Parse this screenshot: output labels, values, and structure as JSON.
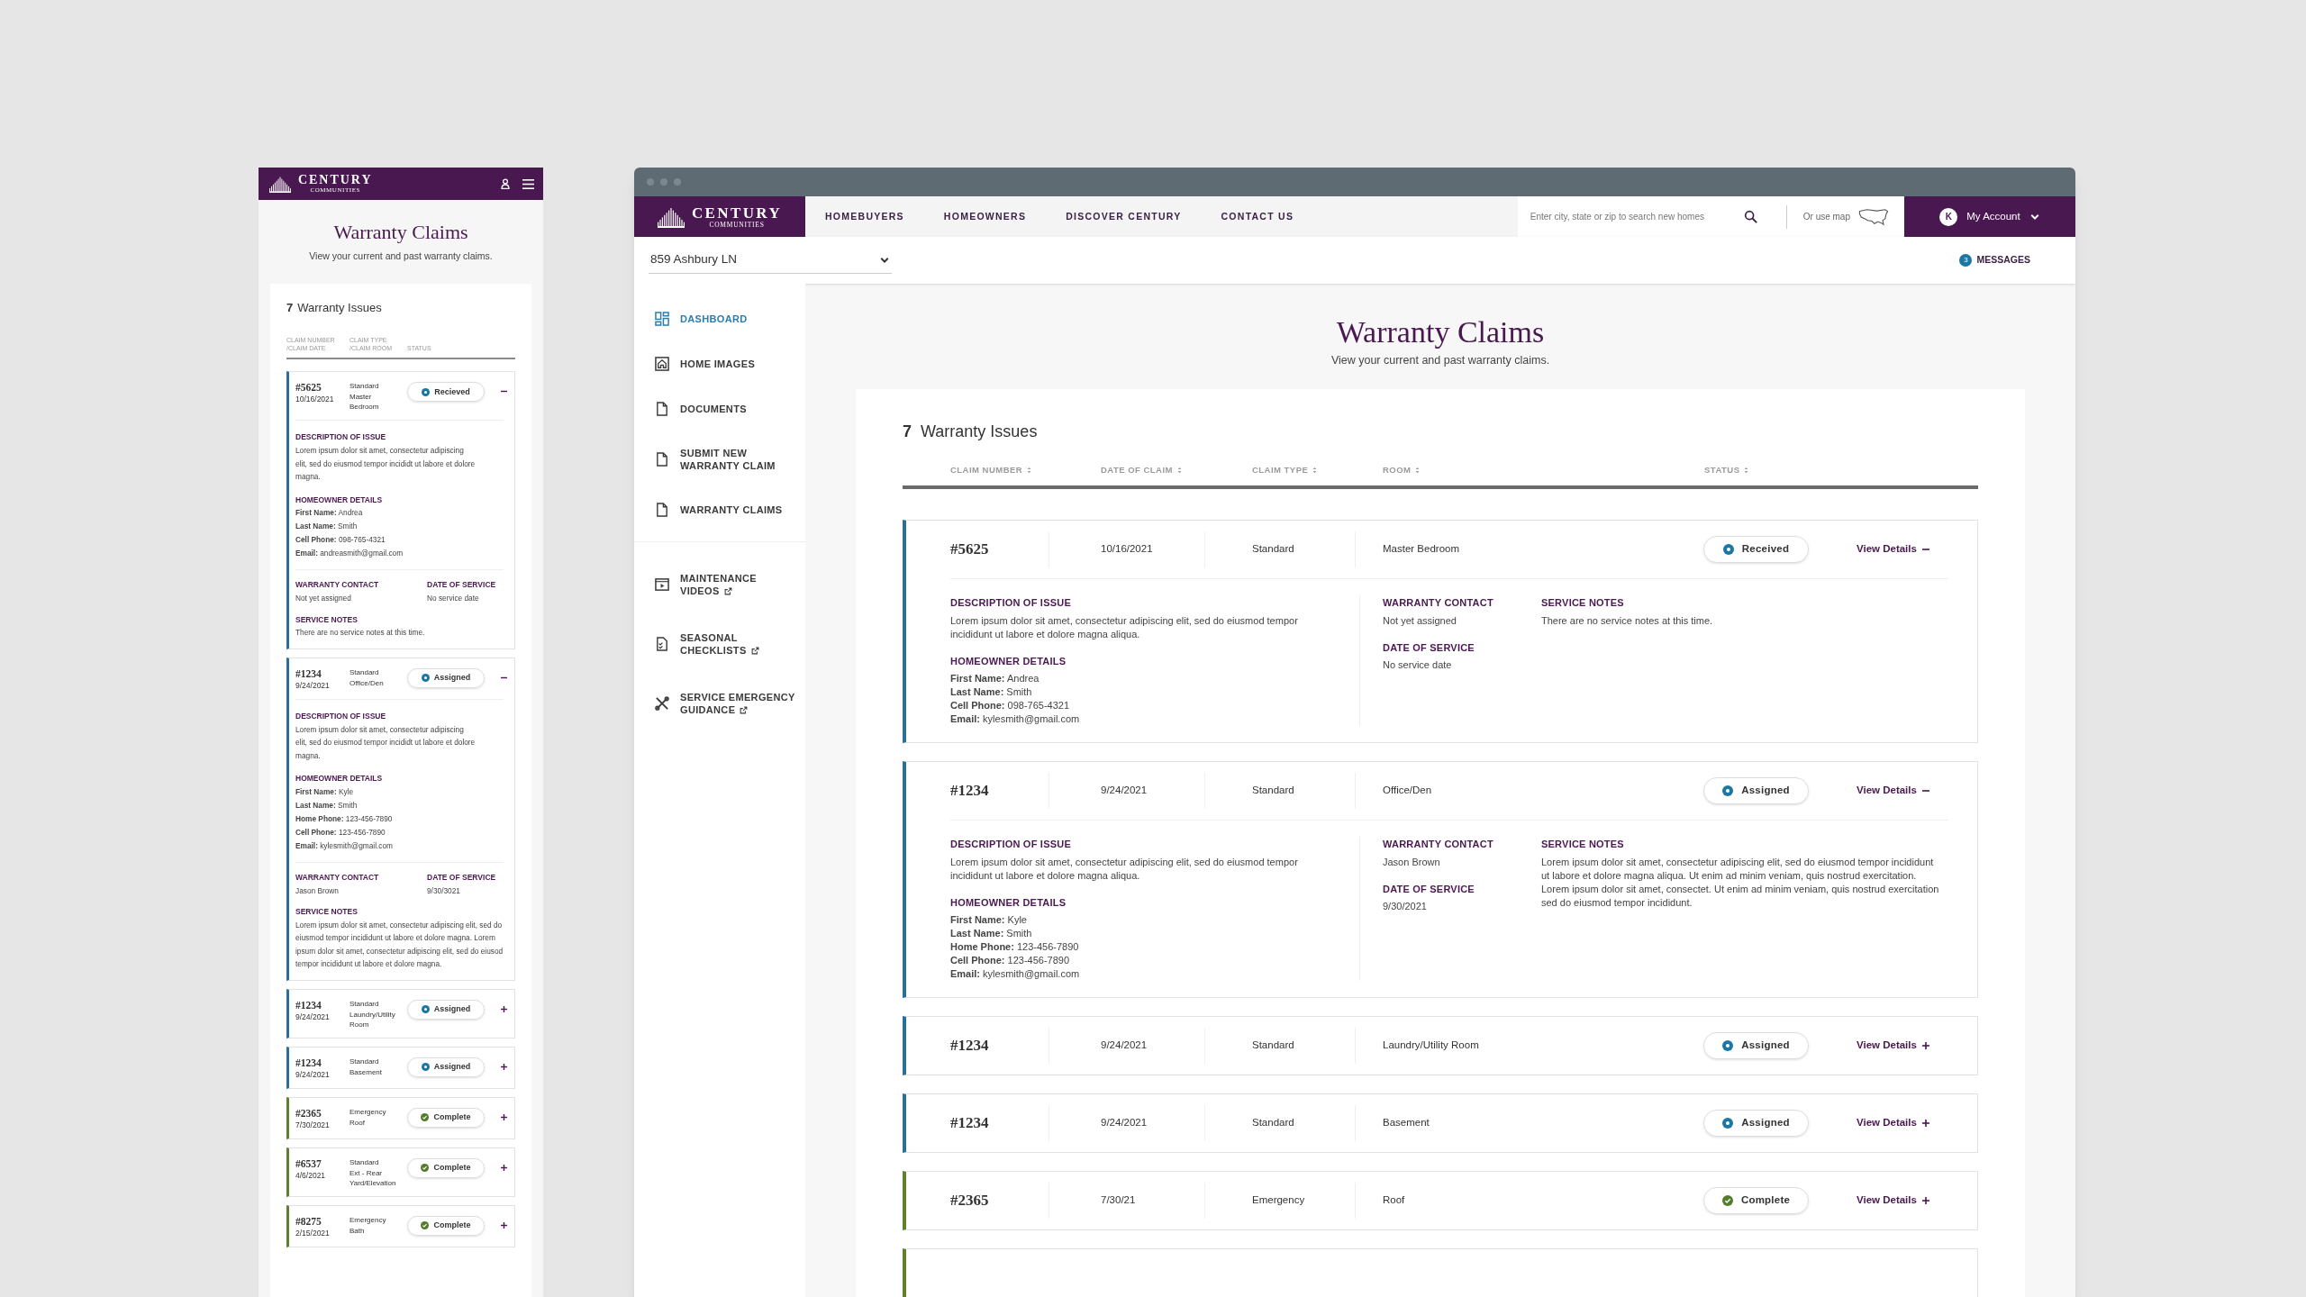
{
  "desktop": {
    "logo": {
      "name": "CENTURY",
      "tagline": "COMMUNITIES"
    },
    "nav": [
      "HOMEBUYERS",
      "HOMEOWNERS",
      "DISCOVER CENTURY",
      "CONTACT US"
    ],
    "search": {
      "placeholder": "Enter city, state or zip to search new homes"
    },
    "map_link": "Or use map",
    "account": {
      "initial": "K",
      "label": "My Account"
    },
    "address": "859 Ashbury LN",
    "messages": {
      "count": "3",
      "label": "MESSAGES"
    },
    "sidebar": {
      "groups": [
        [
          {
            "label": "DASHBOARD",
            "kind": "dashboard",
            "selected": true,
            "external": false
          },
          {
            "label": "HOME IMAGES",
            "kind": "images",
            "selected": false,
            "external": false
          },
          {
            "label": "DOCUMENTS",
            "kind": "document",
            "selected": false,
            "external": false
          },
          {
            "label": "SUBMIT NEW WARRANTY CLAIM",
            "kind": "document",
            "selected": false,
            "external": false
          },
          {
            "label": "WARRANTY CLAIMS",
            "kind": "document",
            "selected": false,
            "external": false
          }
        ],
        [
          {
            "label": "MAINTENANCE VIDEOS",
            "kind": "video",
            "selected": false,
            "external": true
          },
          {
            "label": "SEASONAL CHECKLISTS",
            "kind": "checklist",
            "selected": false,
            "external": true
          },
          {
            "label": "SERVICE EMERGENCY GUIDANCE",
            "kind": "tools",
            "selected": false,
            "external": true
          }
        ]
      ]
    },
    "page": {
      "title": "Warranty Claims",
      "subtitle": "View your current and past warranty claims."
    },
    "issues": {
      "count": "7",
      "label": "Warranty Issues"
    },
    "columns": [
      "CLAIM NUMBER",
      "DATE OF CLAIM",
      "CLAIM TYPE",
      "ROOM",
      "STATUS"
    ],
    "claims": [
      {
        "kind": "claim",
        "number": "#5625",
        "date": "10/16/2021",
        "type": "Standard",
        "room": "Master Bedroom",
        "status": {
          "label": "Received",
          "kind": "received"
        },
        "toggle": "View Details",
        "expanded": true,
        "details": {
          "description_heading": "DESCRIPTION OF ISSUE",
          "description": "Lorem ipsum dolor sit amet, consectetur adipiscing elit, sed do eiusmod tempor incididunt ut labore et dolore magna aliqua.",
          "homeowner_heading": "HOMEOWNER DETAILS",
          "homeowner": [
            "**First Name:** Andrea",
            "**Last Name:** Smith",
            "**Cell Phone:** 098-765-4321",
            "**Email:** kylesmith@gmail.com"
          ],
          "contact_heading": "WARRANTY CONTACT",
          "contact": "Not yet assigned",
          "date_heading": "DATE OF SERVICE",
          "date_of_service": "No service date",
          "notes_heading": "SERVICE NOTES",
          "notes": "There are no service notes at this time."
        }
      },
      {
        "kind": "claim",
        "number": "#1234",
        "date": "9/24/2021",
        "type": "Standard",
        "room": "Office/Den",
        "status": {
          "label": "Assigned",
          "kind": "assigned"
        },
        "toggle": "View Details",
        "expanded": true,
        "details": {
          "description_heading": "DESCRIPTION OF ISSUE",
          "description": "Lorem ipsum dolor sit amet, consectetur adipiscing elit, sed do eiusmod tempor incididunt ut labore et dolore magna aliqua.",
          "homeowner_heading": "HOMEOWNER DETAILS",
          "homeowner": [
            "**First Name:** Kyle",
            "**Last Name:** Smith",
            "**Home Phone:** 123-456-7890",
            "**Cell Phone:** 123-456-7890",
            "**Email:** kylesmith@gmail.com"
          ],
          "contact_heading": "WARRANTY CONTACT",
          "contact": "Jason Brown",
          "date_heading": "DATE OF SERVICE",
          "date_of_service": "9/30/2021",
          "notes_heading": "SERVICE NOTES",
          "notes": "Lorem ipsum dolor sit amet, consectetur adipiscing elit, sed do eiusmod tempor incididunt ut labore et dolore magna aliqua. Ut enim ad minim veniam, quis nostrud exercitation. Lorem ipsum dolor sit amet, consectet. Ut enim ad minim veniam, quis nostrud exercitation sed do eiusmod tempor incididunt."
        }
      },
      {
        "kind": "claim",
        "number": "#1234",
        "date": "9/24/2021",
        "type": "Standard",
        "room": "Laundry/Utility Room",
        "status": {
          "label": "Assigned",
          "kind": "assigned"
        },
        "toggle": "View Details",
        "expanded": false
      },
      {
        "kind": "claim",
        "number": "#1234",
        "date": "9/24/2021",
        "type": "Standard",
        "room": "Basement",
        "status": {
          "label": "Assigned",
          "kind": "assigned"
        },
        "toggle": "View Details",
        "expanded": false
      },
      {
        "kind": "claim",
        "number": "#2365",
        "date": "7/30/21",
        "type": "Emergency",
        "room": "Roof",
        "status": {
          "label": "Complete",
          "kind": "complete"
        },
        "toggle": "View Details",
        "expanded": false
      },
      {
        "kind": "stub",
        "status": {
          "kind": "complete"
        }
      }
    ]
  },
  "mobile": {
    "logo": {
      "name": "CENTURY",
      "tagline": "COMMUNITIES"
    },
    "page": {
      "title": "Warranty Claims",
      "subtitle": "View your current and past warranty claims."
    },
    "issues": {
      "count": "7",
      "label": "Warranty Issues"
    },
    "columns": [
      "CLAIM NUMBER /CLAIM DATE",
      "CLAIM TYPE /CLAIM ROOM",
      "STATUS"
    ],
    "claims": [
      {
        "number": "#5625",
        "date": "10/16/2021",
        "type": "Standard",
        "room": "Master Bedroom",
        "status": {
          "label": "Recieved",
          "kind": "received"
        },
        "expanded": true,
        "details": {
          "description_heading": "DESCRIPTION OF ISSUE",
          "description": "Lorem ipsum dolor sit amet, consectetur adipiscing elit, sed do eiusmod tempor incididt ut labore et dolore magna.",
          "homeowner_heading": "HOMEOWNER DETAILS",
          "homeowner": [
            "**First Name:** Andrea",
            "**Last Name:** Smith",
            "**Cell Phone:** 098-765-4321",
            "**Email:** andreasmith@gmail.com"
          ],
          "contact_heading": "WARRANTY CONTACT",
          "contact": "Not yet assigned",
          "date_heading": "DATE OF SERVICE",
          "date_of_service": "No service date",
          "notes_heading": "SERVICE NOTES",
          "notes": "There are no service notes at this time."
        }
      },
      {
        "number": "#1234",
        "date": "9/24/2021",
        "type": "Standard",
        "room": "Office/Den",
        "status": {
          "label": "Assigned",
          "kind": "assigned"
        },
        "expanded": true,
        "details": {
          "description_heading": "DESCRIPTION OF ISSUE",
          "description": "Lorem ipsum dolor sit amet, consectetur adipiscing elit, sed do eiusmod tempor incididt ut labore et dolore magna.",
          "homeowner_heading": "HOMEOWNER DETAILS",
          "homeowner": [
            "**First Name:** Kyle",
            "**Last Name:** Smith",
            "**Home Phone:** 123-456-7890",
            "**Cell Phone:** 123-456-7890",
            "**Email:** kylesmith@gmail.com"
          ],
          "contact_heading": "WARRANTY CONTACT",
          "contact": "Jason Brown",
          "date_heading": "DATE OF SERVICE",
          "date_of_service": "9/30/3021",
          "notes_heading": "SERVICE NOTES",
          "notes": "Lorem ipsum dolor sit amet, consectetur adipiscing elit, sed do eiusmod tempor incididunt ut labore et dolore magna. Lorem ipsum dolor sit amet, consectetur adipiscing elit, sed do eiusod tempor incididunt ut labore et dolore magna."
        }
      },
      {
        "number": "#1234",
        "date": "9/24/2021",
        "type": "Standard",
        "room": "Laundry/Utility Room",
        "status": {
          "label": "Assigned",
          "kind": "assigned"
        },
        "expanded": false
      },
      {
        "number": "#1234",
        "date": "9/24/2021",
        "type": "Standard",
        "room": "Basement",
        "status": {
          "label": "Assigned",
          "kind": "assigned"
        },
        "expanded": false
      },
      {
        "number": "#2365",
        "date": "7/30/2021",
        "type": "Emergency",
        "room": "Roof",
        "status": {
          "label": "Complete",
          "kind": "complete"
        },
        "expanded": false
      },
      {
        "number": "#6537",
        "date": "4/6/2021",
        "type": "Standard",
        "room": "Ext - Rear Yard/Elevation",
        "status": {
          "label": "Complete",
          "kind": "complete"
        },
        "expanded": false
      },
      {
        "number": "#8275",
        "date": "2/15/2021",
        "type": "Emergency",
        "room": "Bath",
        "status": {
          "label": "Complete",
          "kind": "complete"
        },
        "expanded": false
      }
    ]
  }
}
